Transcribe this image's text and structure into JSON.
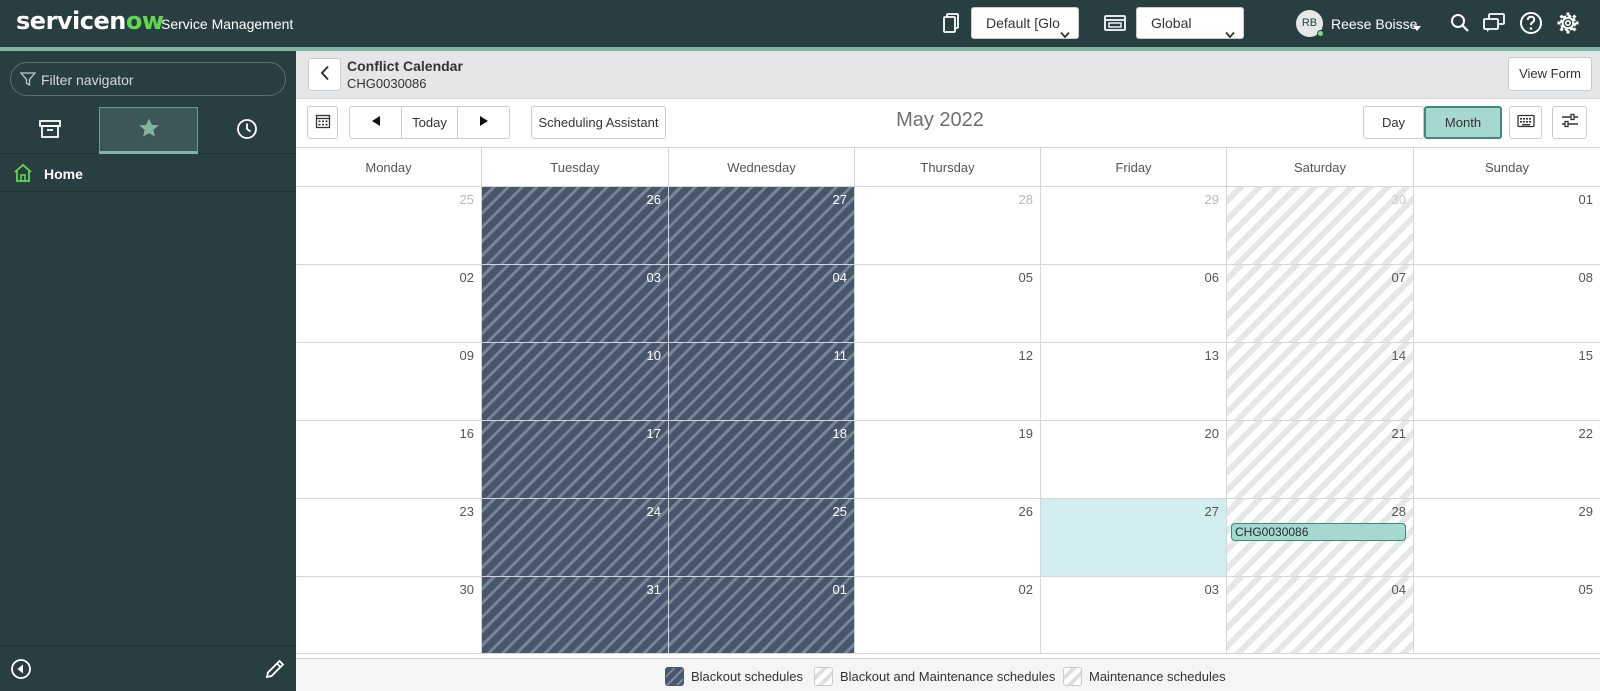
{
  "header": {
    "logo_service": "service",
    "logo_n": "n",
    "logo_ow": "ow",
    "app_name": "Service Management",
    "update_set_value": "Default [Glo",
    "scope_value": "Global",
    "user_initials": "RB",
    "user_name": "Reese Boisse",
    "icons": [
      "update-set-icon",
      "application-scope-icon",
      "search-icon",
      "connect-chat-icon",
      "help-icon",
      "settings-gear-icon"
    ]
  },
  "sidebar": {
    "filter_placeholder": "Filter navigator",
    "tabs": [
      "all-apps-archive-icon",
      "favorites-star-icon",
      "history-clock-icon"
    ],
    "active_tab": "favorites",
    "home_label": "Home"
  },
  "form": {
    "title": "Conflict Calendar",
    "subtitle": "CHG0030086",
    "view_form_label": "View Form"
  },
  "toolbar": {
    "today_label": "Today",
    "scheduling_label": "Scheduling Assistant",
    "month_title": "May 2022",
    "day_label": "Day",
    "month_label": "Month",
    "active_view": "Month"
  },
  "calendar": {
    "days_of_week": [
      "Monday",
      "Tuesday",
      "Wednesday",
      "Thursday",
      "Friday",
      "Saturday",
      "Sunday"
    ],
    "weeks": [
      [
        "25",
        "26",
        "27",
        "28",
        "29",
        "30",
        "01"
      ],
      [
        "02",
        "03",
        "04",
        "05",
        "06",
        "07",
        "08"
      ],
      [
        "09",
        "10",
        "11",
        "12",
        "13",
        "14",
        "15"
      ],
      [
        "16",
        "17",
        "18",
        "19",
        "20",
        "21",
        "22"
      ],
      [
        "23",
        "24",
        "25",
        "26",
        "27",
        "28",
        "29"
      ],
      [
        "30",
        "31",
        "01",
        "02",
        "03",
        "04",
        "05"
      ]
    ],
    "dim_days_first_week": [
      "25",
      "26",
      "27",
      "28",
      "29",
      "30"
    ],
    "blackout_columns": [
      "Tuesday",
      "Wednesday"
    ],
    "maintenance_columns": [
      "Saturday"
    ],
    "highlighted_day": "27",
    "event": {
      "label": "CHG0030086",
      "day": "28"
    }
  },
  "legend": {
    "blackout": "Blackout schedules",
    "blackout_maintenance": "Blackout and Maintenance schedules",
    "maintenance": "Maintenance schedules"
  },
  "colors": {
    "header_bg": "#293e40",
    "accent": "#81b5a1",
    "blackout": "#47566b",
    "event_fill": "#a7d8cf",
    "today_fill": "#d1edf0"
  }
}
